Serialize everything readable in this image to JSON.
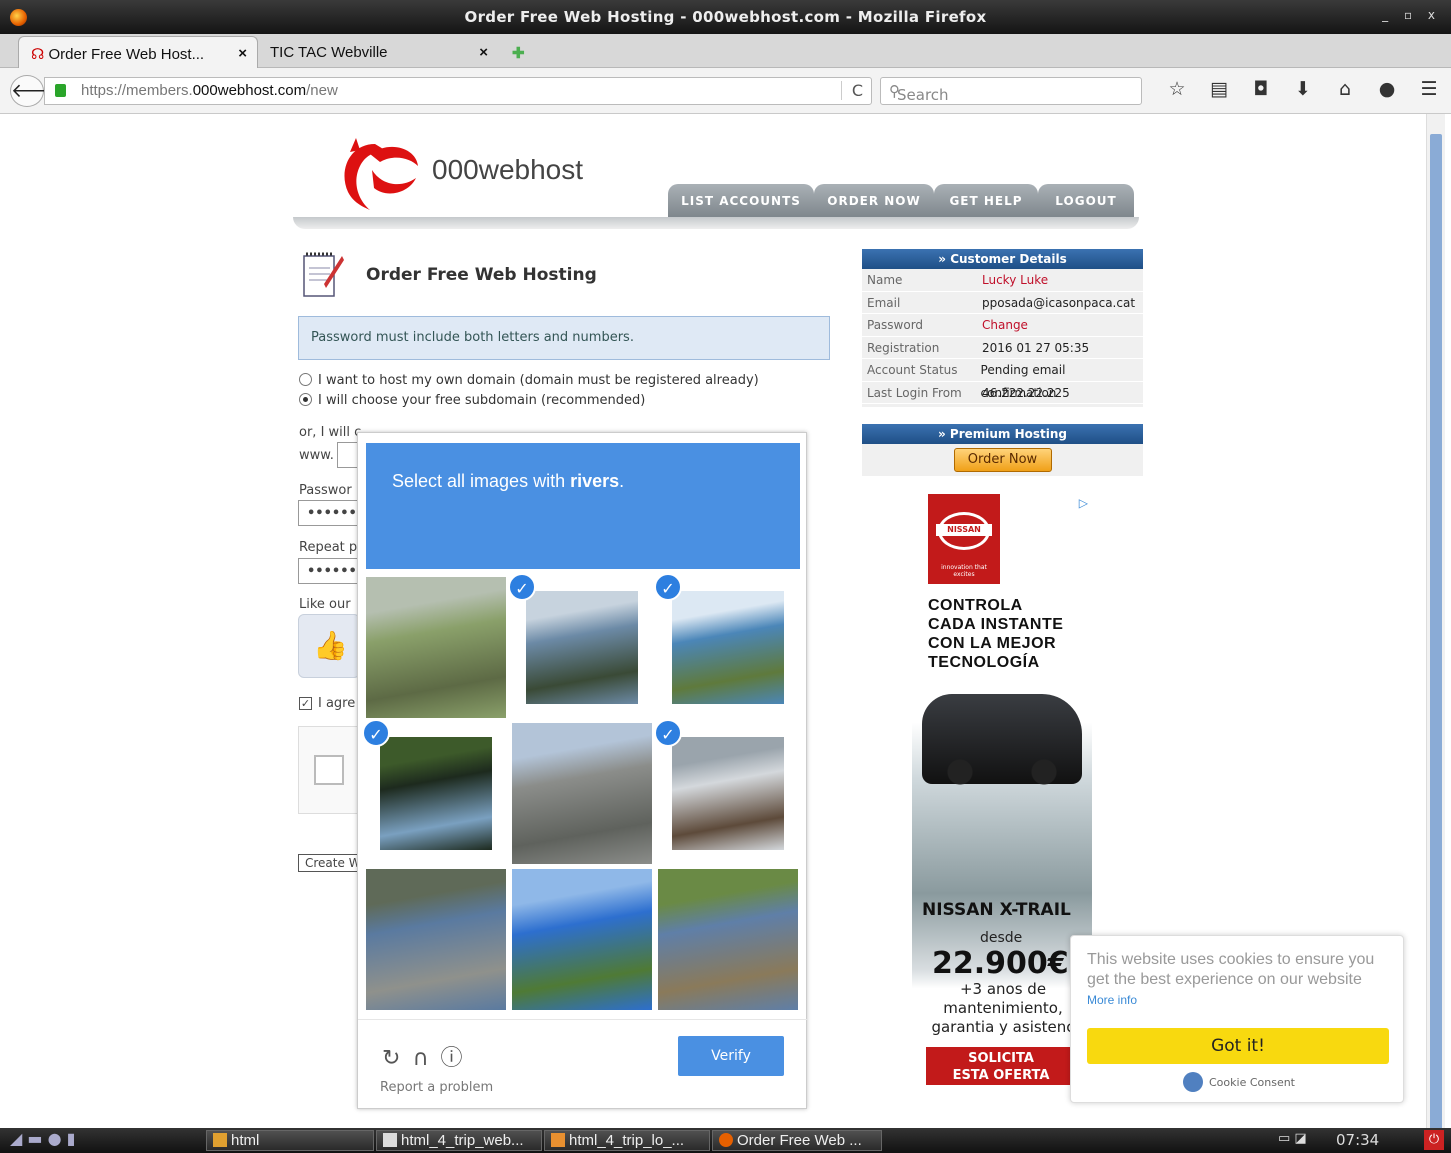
{
  "window": {
    "title": "Order Free Web Hosting - 000webhost.com - Mozilla Firefox",
    "controls": "_ ▫ x"
  },
  "tabs": [
    {
      "label": "Order Free Web Host...",
      "close": "×"
    },
    {
      "label": "TIC TAC Webville",
      "close": "×"
    }
  ],
  "new_tab": "✚",
  "nav": {
    "back": "🡐",
    "url_prefix": "https://members.",
    "url_domain": "000webhost.com",
    "url_path": "/new",
    "reload": "C",
    "search_placeholder": "Search",
    "icons": [
      "star-icon",
      "reading-list-icon",
      "pocket-icon",
      "download-icon",
      "home-icon",
      "chat-icon",
      "menu-icon"
    ]
  },
  "site": {
    "logo_text": "000webhost",
    "menu": [
      "LIST ACCOUNTS",
      "ORDER NOW",
      "GET HELP",
      "LOGOUT"
    ],
    "page_title": "Order Free Web Hosting",
    "info_message": "Password must include both letters and numbers.",
    "radio_own": "I want to host my own domain (domain must be registered already)",
    "radio_sub": "I will choose your free subdomain (recommended)",
    "or_text": "or, I will c",
    "www": "www.",
    "password_label": "Passwor",
    "password_value": "•••••••",
    "repeat_label": "Repeat p",
    "repeat_value": "•••••••",
    "like_label": "Like our",
    "agree_label": "I agre",
    "create_btn": "Create W"
  },
  "customer": {
    "header": "» Customer Details",
    "rows": [
      {
        "k": "Name",
        "v": "Lucky Luke"
      },
      {
        "k": "Email",
        "v": "pposada@icasonpaca.cat"
      },
      {
        "k": "Password",
        "v": "Change"
      },
      {
        "k": "Registration",
        "v": "2016 01 27 05:35"
      },
      {
        "k": "Account Status",
        "v": "Pending email confirmation"
      },
      {
        "k": "Last Login From",
        "v": "46.222.22.225"
      }
    ]
  },
  "premium": {
    "header": "» Premium Hosting",
    "button": "Order Now"
  },
  "ad": {
    "brand": "NISSAN",
    "tagline": "innovation that excites",
    "headline": [
      "CONTROLA",
      "CADA INSTANTE",
      "CON LA MEJOR",
      "TECNOLOGÍA"
    ],
    "model": "NISSAN X-TRAIL",
    "desde": "desde",
    "price": "22.900€",
    "small": [
      "+3 anos de",
      "mantenimiento,",
      "garantia y asistenc"
    ],
    "cta": [
      "SOLICITA",
      "ESTA OFERTA"
    ],
    "info": "▷"
  },
  "captcha": {
    "prompt_pre": "Select all images with",
    "prompt_bold": "rivers",
    "prompt_post": ".",
    "tiles": [
      {
        "selected": false,
        "colors": [
          "#8aa06a",
          "#5d6a45",
          "#b5bfb0"
        ]
      },
      {
        "selected": true,
        "colors": [
          "#6c8aa6",
          "#3a4a36",
          "#c7d3de"
        ]
      },
      {
        "selected": true,
        "colors": [
          "#4b86b8",
          "#5f7a3c",
          "#dce8f3"
        ]
      },
      {
        "selected": true,
        "colors": [
          "#1d2a1e",
          "#7aa0c0",
          "#3d5a2a"
        ]
      },
      {
        "selected": false,
        "colors": [
          "#8b8d8a",
          "#5f625d",
          "#b3c4d8"
        ]
      },
      {
        "selected": true,
        "colors": [
          "#d4d8dc",
          "#5d4a3a",
          "#9aa4ac"
        ]
      },
      {
        "selected": false,
        "colors": [
          "#5a7aa0",
          "#8f918c",
          "#5f6a58"
        ]
      },
      {
        "selected": false,
        "colors": [
          "#2d6fcf",
          "#4f7a35",
          "#8fb8e8"
        ]
      },
      {
        "selected": false,
        "colors": [
          "#5f7fa8",
          "#8a7a5a",
          "#6a8a45"
        ]
      }
    ],
    "verify": "Verify",
    "report": "Report a problem",
    "icons": "C ∩ ⓘ"
  },
  "cookie": {
    "message": "This website uses cookies to ensure you get the best experience on our website",
    "more": "More info",
    "button": "Got it!",
    "brand": "Cookie Consent"
  },
  "taskbar": {
    "items": [
      "html",
      "html_4_trip_web...",
      "html_4_trip_lo_...",
      "Order Free Web ..."
    ],
    "clock": "07:34"
  }
}
